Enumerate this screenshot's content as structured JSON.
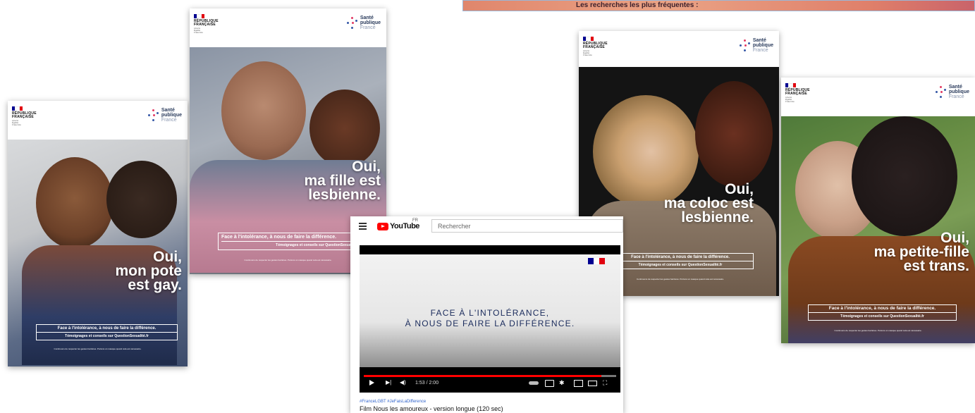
{
  "top_strip": {
    "text": "Les recherches les plus fréquentes :"
  },
  "brand": {
    "republique": "RÉPUBLIQUE\nFRANÇAISE",
    "motto": "Liberté\nÉgalité\nFraternité",
    "sante_line1": "Santé",
    "sante_line2": "publique",
    "sante_line3": "France"
  },
  "posters": [
    {
      "headline": "Oui,\nmon pote\nest gay.",
      "tagline": "Face à l'intolérance, à nous de faire la différence.",
      "subline": "Témoignages et conseils sur QuestionSexualité.fr",
      "footer": "Continuons de respecter les gestes barrières. Portons un masque quand cela est nécessaire."
    },
    {
      "headline": "Oui,\nma fille est\nlesbienne.",
      "tagline": "Face à l'intolérance, à nous de faire la différence.",
      "subline": "Témoignages et conseils sur QuestionSexualité.fr",
      "footer": "Continuons de respecter les gestes barrières. Portons un masque quand cela est nécessaire."
    },
    {
      "headline": "Oui,\nma coloc est\nlesbienne.",
      "tagline": "Face à l'intolérance, à nous de faire la différence.",
      "subline": "Témoignages et conseils sur QuestionSexualité.fr",
      "footer": "Continuons de respecter les gestes barrières. Portons un masque quand cela est nécessaire."
    },
    {
      "headline": "Oui,\nma petite-fille\nest trans.",
      "tagline": "Face à l'intolérance, à nous de faire la différence.",
      "subline": "Témoignages et conseils sur QuestionSexualité.fr",
      "footer": "Continuons de respecter les gestes barrières. Portons un masque quand cela est nécessaire."
    }
  ],
  "youtube": {
    "logo": "YouTube",
    "region": "FR",
    "search_placeholder": "Rechercher",
    "video_message": "FACE À L'INTOLÉRANCE,\nÀ NOUS DE FAIRE LA DIFFÉRENCE.",
    "time": "1:53 / 2:00",
    "progress": 0.94,
    "hashtags": "#FranceLGBT #JeFaisLaDifference",
    "title": "Film Nous les amoureux - version longue (120 sec)"
  },
  "colors": {
    "flag_blue": "#000091",
    "flag_white": "#ffffff",
    "flag_red": "#e1000f",
    "yt_red": "#ff0000"
  }
}
